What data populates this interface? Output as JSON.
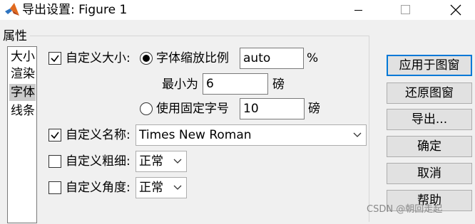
{
  "window": {
    "title": "导出设置: Figure 1",
    "controls": [
      "minimize",
      "maximize",
      "close"
    ]
  },
  "properties": {
    "group_label": "属性",
    "categories": [
      {
        "label": "大小",
        "selected": false
      },
      {
        "label": "渲染",
        "selected": false
      },
      {
        "label": "字体",
        "selected": true
      },
      {
        "label": "线条",
        "selected": false
      }
    ]
  },
  "font_settings": {
    "custom_size": {
      "label": "自定义大小:",
      "checked": true
    },
    "scale_option": {
      "label": "字体缩放比例",
      "selected": true,
      "value": "auto",
      "unit": "%"
    },
    "min_size": {
      "label": "最小为",
      "value": "6",
      "unit": "磅"
    },
    "fixed_option": {
      "label": "使用固定字号",
      "selected": false,
      "value": "10",
      "unit": "磅"
    },
    "custom_name": {
      "label": "自定义名称:",
      "checked": true,
      "value": "Times New Roman"
    },
    "custom_weight": {
      "label": "自定义粗细:",
      "checked": false,
      "value": "正常"
    },
    "custom_angle": {
      "label": "自定义角度:",
      "checked": false,
      "value": "正常"
    }
  },
  "buttons": {
    "apply": "应用于图窗",
    "restore": "还原图窗",
    "export": "导出...",
    "ok": "确定",
    "cancel": "取消",
    "help": "帮助"
  },
  "watermark": "CSDN @朝回走起",
  "colors": {
    "accent": "#0078d7",
    "window_bg": "#f0f0f0",
    "list_selection": "#cccccc"
  }
}
